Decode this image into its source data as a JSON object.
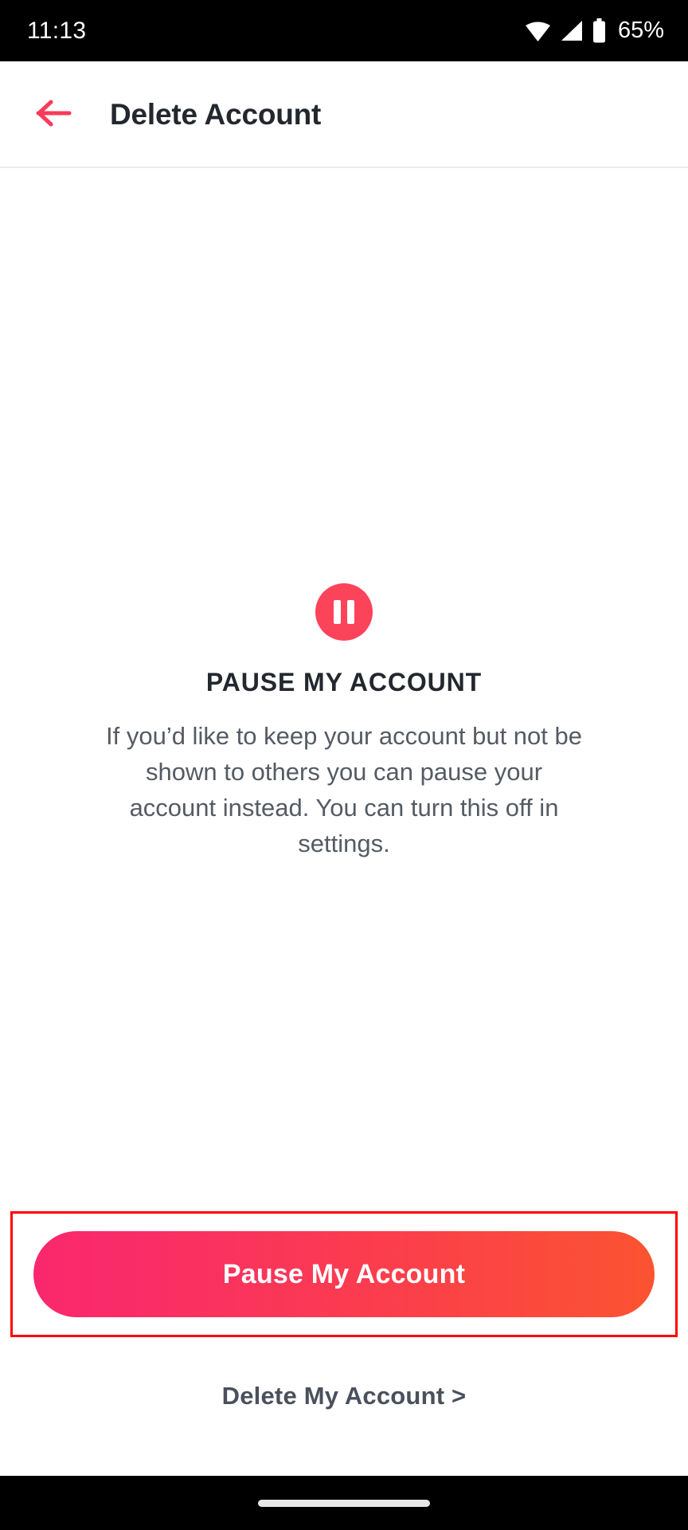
{
  "status_bar": {
    "time": "11:13",
    "battery_percent": "65%",
    "icons": [
      "wifi-icon",
      "cellular-signal-icon",
      "battery-icon"
    ],
    "background_color": "#000000",
    "foreground_color": "#ffffff"
  },
  "header": {
    "title": "Delete Account",
    "back_icon": "back-arrow-icon",
    "back_icon_color": "#f93a5a",
    "title_color": "#23272e"
  },
  "main": {
    "badge_icon": "pause-icon",
    "badge_color": "#fb4359",
    "heading": "PAUSE MY ACCOUNT",
    "body": "If you’d like to keep your account but not be shown to others you can pause your account instead. You can turn this off in settings."
  },
  "actions": {
    "primary_label": "Pause My Account",
    "primary_gradient_start": "#f9286e",
    "primary_gradient_end": "#fb5331",
    "secondary_label": "Delete My Account >",
    "secondary_color": "#4a505c",
    "highlight_border_color": "#ff0000"
  },
  "nav_bar": {
    "home_indicator": "home-gesture-indicator",
    "background_color": "#000000"
  }
}
